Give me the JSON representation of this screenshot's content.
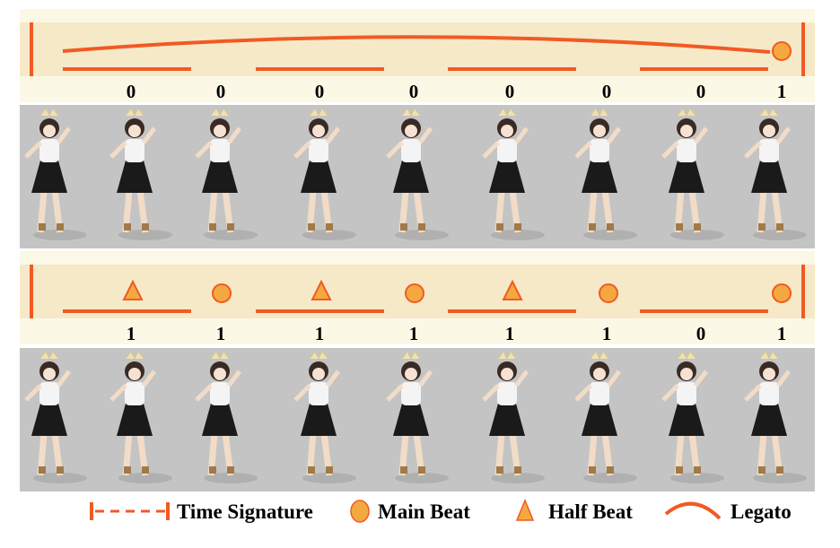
{
  "colors": {
    "outer_band": "#fbf9e6",
    "inner_band": "#f6e9c8",
    "accent": "#f15a24",
    "beat_fill": "#f4a940",
    "frame_bg": "#c4c4c4"
  },
  "row1": {
    "beats": [
      0,
      0,
      0,
      0,
      0,
      0,
      0,
      1
    ],
    "markers": [
      "none",
      "none",
      "none",
      "none",
      "none",
      "none",
      "none",
      "main"
    ],
    "legato": true
  },
  "row2": {
    "beats": [
      1,
      1,
      1,
      1,
      1,
      1,
      0,
      1
    ],
    "markers": [
      "half",
      "main",
      "half",
      "main",
      "half",
      "main",
      "none",
      "main"
    ],
    "legato": false
  },
  "frames_per_row": 9,
  "legend": {
    "time_signature": "Time Signature",
    "main_beat": "Main Beat",
    "half_beat": "Half Beat",
    "legato": "Legato"
  }
}
